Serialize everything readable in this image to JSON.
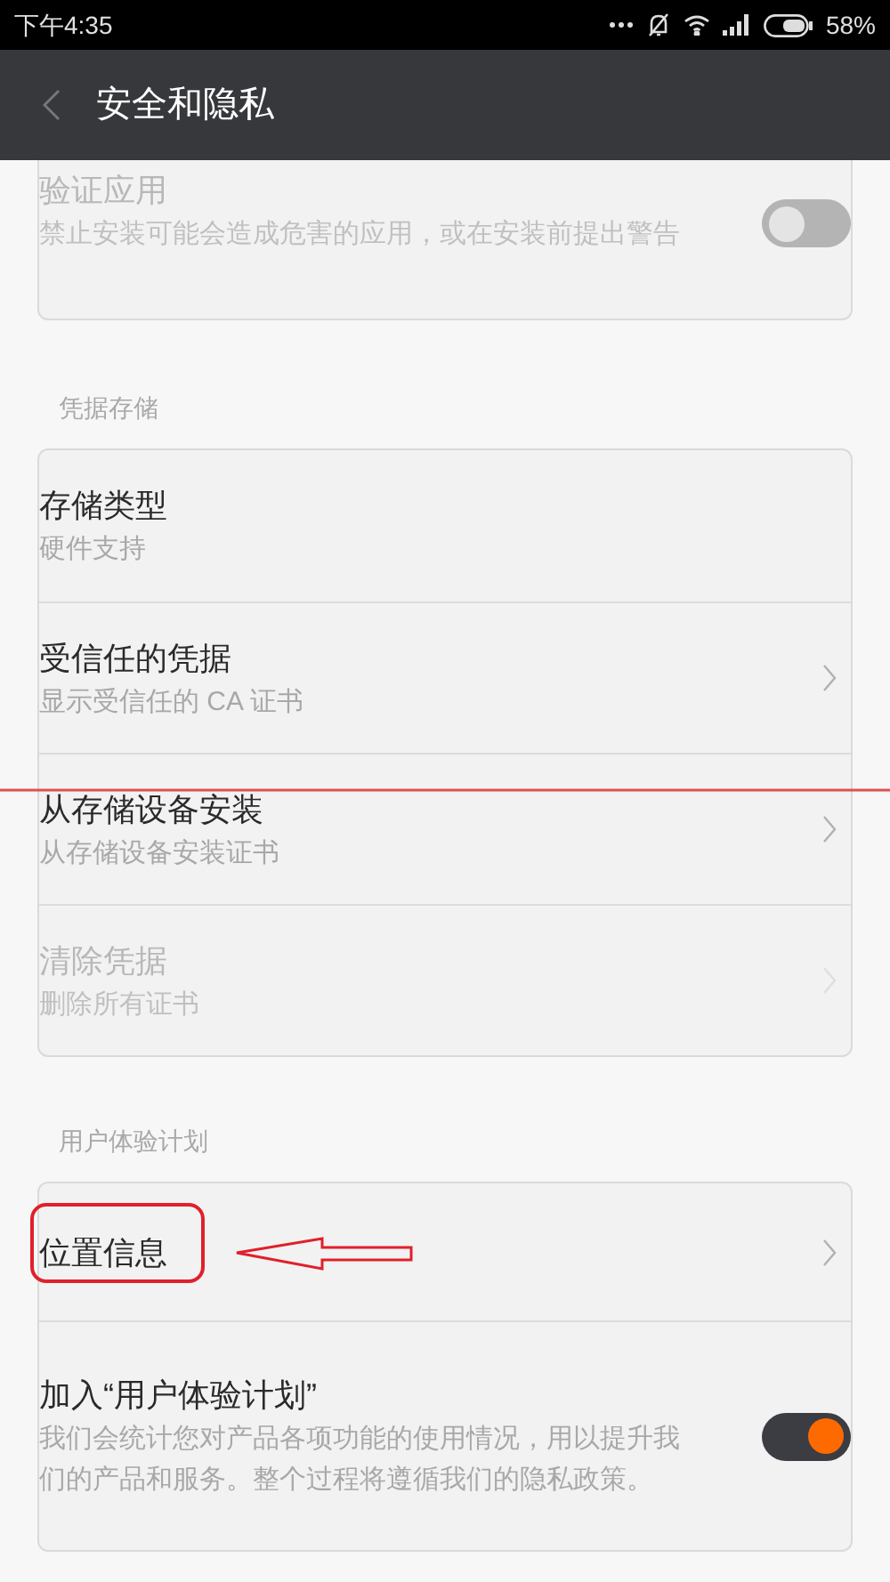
{
  "status_bar": {
    "time": "下午4:35",
    "battery": "58%"
  },
  "header": {
    "title": "安全和隐私"
  },
  "sections": [
    {
      "items": [
        {
          "kind": "toggle",
          "title": "验证应用",
          "subtitle": "禁止安装可能会造成危害的应用，或在安装前提出警告",
          "on": false,
          "disabled": true
        }
      ]
    },
    {
      "header": "凭据存储",
      "items": [
        {
          "kind": "info",
          "title": "存储类型",
          "subtitle": "硬件支持",
          "disabled": false
        },
        {
          "kind": "link",
          "title": "受信任的凭据",
          "subtitle": "显示受信任的 CA 证书",
          "disabled": false
        },
        {
          "kind": "link",
          "title": "从存储设备安装",
          "subtitle": "从存储设备安装证书",
          "disabled": false
        },
        {
          "kind": "link",
          "title": "清除凭据",
          "subtitle": "删除所有证书",
          "disabled": true
        }
      ]
    },
    {
      "header": "用户体验计划",
      "items": [
        {
          "kind": "link",
          "title": "位置信息",
          "disabled": false
        },
        {
          "kind": "toggle",
          "title": "加入“用户体验计划”",
          "subtitle": "我们会统计您对产品各项功能的使用情况，用以提升我们的产品和服务。整个过程将遵循我们的隐私政策。",
          "on": true,
          "disabled": false
        }
      ]
    }
  ]
}
